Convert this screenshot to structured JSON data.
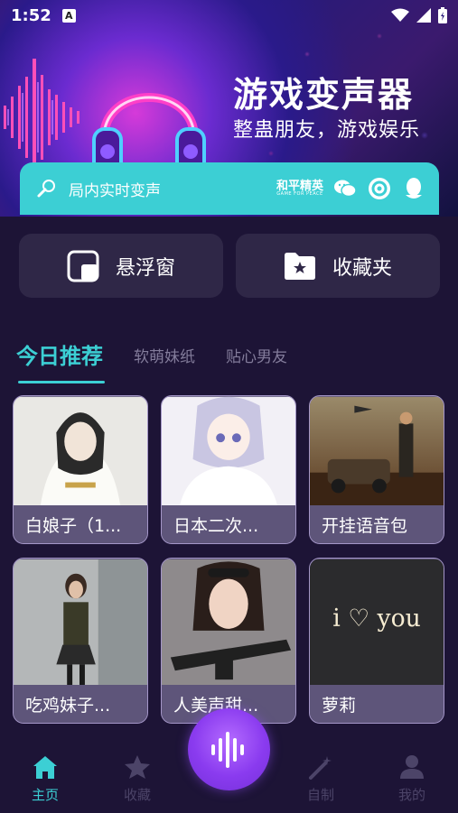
{
  "status_bar": {
    "time": "1:52",
    "notification_badge": "A"
  },
  "hero": {
    "title": "游戏变声器",
    "subtitle": "整蛊朋友，游戏娱乐"
  },
  "strip": {
    "label": "局内实时变声",
    "game_logo_title": "和平精英",
    "game_logo_sub": "GAME FOR PEACE",
    "icons": [
      "wechat-icon",
      "qq-game-icon",
      "qq-penguin-icon"
    ]
  },
  "actions": {
    "floating_window": "悬浮窗",
    "favorites_folder": "收藏夹"
  },
  "tabs": [
    {
      "label": "今日推荐",
      "active": true
    },
    {
      "label": "软萌妹纸",
      "active": false
    },
    {
      "label": "贴心男友",
      "active": false
    }
  ],
  "cards": [
    {
      "title": "白娘子（1..."
    },
    {
      "title": "日本二次..."
    },
    {
      "title": "开挂语音包"
    },
    {
      "title": "吃鸡妹子..."
    },
    {
      "title": "人美声甜..."
    },
    {
      "title": "萝莉"
    }
  ],
  "card_images": {
    "neon_text": "i ♡ you"
  },
  "nav": {
    "home": "主页",
    "favorites": "收藏",
    "custom": "自制",
    "mine": "我的"
  },
  "colors": {
    "accent": "#3ccfd4",
    "background": "#1d1436",
    "card": "#5e557a",
    "mic": "#8a3bef"
  }
}
